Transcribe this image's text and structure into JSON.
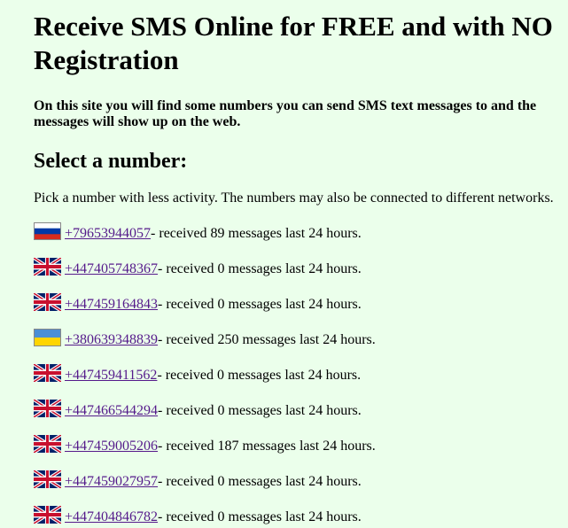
{
  "heading": "Receive SMS Online for FREE and with NO Registration",
  "intro": "On this site you will find some numbers you can send SMS text messages to and the messages will show up on the web.",
  "select_heading": "Select a number:",
  "pick_text": "Pick a number with less activity. The numbers may also be connected to different networks.",
  "numbers": [
    {
      "flag": "russia-flag-icon",
      "number": "+79653944057",
      "suffix": " - received 89 messages last 24 hours."
    },
    {
      "flag": "uk-flag-icon",
      "number": "+447405748367",
      "suffix": " - received 0 messages last 24 hours."
    },
    {
      "flag": "uk-flag-icon",
      "number": "+447459164843",
      "suffix": " - received 0 messages last 24 hours."
    },
    {
      "flag": "ukraine-flag-icon",
      "number": "+380639348839",
      "suffix": " - received 250 messages last 24 hours."
    },
    {
      "flag": "uk-flag-icon",
      "number": "+447459411562",
      "suffix": " - received 0 messages last 24 hours."
    },
    {
      "flag": "uk-flag-icon",
      "number": "+447466544294",
      "suffix": " - received 0 messages last 24 hours."
    },
    {
      "flag": "uk-flag-icon",
      "number": "+447459005206",
      "suffix": " - received 187 messages last 24 hours."
    },
    {
      "flag": "uk-flag-icon",
      "number": "+447459027957",
      "suffix": " - received 0 messages last 24 hours."
    },
    {
      "flag": "uk-flag-icon",
      "number": "+447404846782",
      "suffix": " - received 0 messages last 24 hours."
    }
  ],
  "colors": {
    "background": "#ebffeb",
    "link": "#551a8b"
  }
}
